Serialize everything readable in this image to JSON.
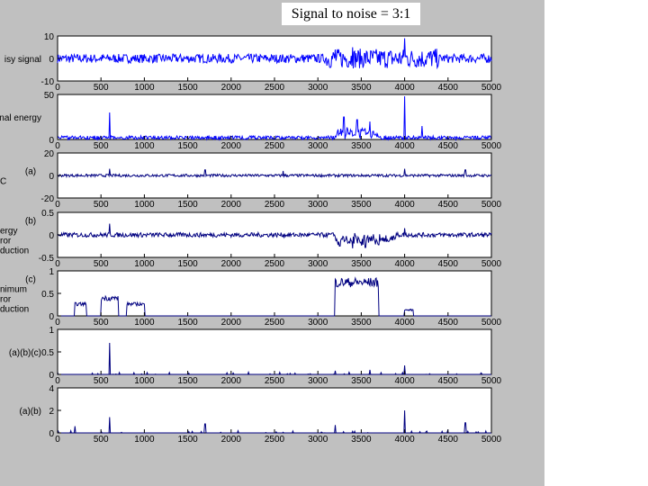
{
  "title": "Signal to noise = 3:1",
  "chart_data": [
    {
      "type": "line",
      "ylabel": "isy signal",
      "ylim": [
        -10,
        10
      ],
      "yticks": [
        "10",
        "0",
        "-10"
      ],
      "noise": 2,
      "spikes": [
        [
          3200,
          4
        ],
        [
          3400,
          5
        ],
        [
          4000,
          9
        ],
        [
          4300,
          3
        ]
      ],
      "color": "#0000ff"
    },
    {
      "type": "line",
      "ylabel": "nal energy",
      "ylim": [
        0,
        50
      ],
      "yticks": [
        "50",
        "0"
      ],
      "noise": 4,
      "spikes": [
        [
          600,
          30
        ],
        [
          3300,
          25
        ],
        [
          3450,
          22
        ],
        [
          3600,
          20
        ],
        [
          4000,
          48
        ],
        [
          4200,
          15
        ]
      ],
      "color": "#0000ff"
    },
    {
      "type": "line",
      "ylabel": "(a)\nC",
      "ylim": [
        -20,
        20
      ],
      "yticks": [
        "20",
        "0",
        "-20"
      ],
      "noise": 1.2,
      "spikes": [
        [
          600,
          6
        ],
        [
          1700,
          5
        ],
        [
          2600,
          4
        ],
        [
          4000,
          6
        ],
        [
          4700,
          5
        ]
      ],
      "color": "#000080"
    },
    {
      "type": "line",
      "ylabel": "(b)\nergy\nror\nduction",
      "ylim": [
        -0.5,
        0.5
      ],
      "yticks": [
        "0.5",
        "0",
        "-0.5"
      ],
      "noise": 0.05,
      "spikes": [
        [
          600,
          0.25
        ],
        [
          3250,
          -0.25
        ],
        [
          3400,
          -0.3
        ],
        [
          3550,
          -0.28
        ],
        [
          3700,
          -0.22
        ],
        [
          4000,
          0.15
        ]
      ],
      "color": "#000080"
    },
    {
      "type": "line",
      "ylabel": "(c)\nnimum\nror\nduction",
      "ylim": [
        0,
        1
      ],
      "yticks": [
        "1",
        "0.5",
        "0"
      ],
      "plateaus": [
        [
          200,
          330,
          0.3
        ],
        [
          500,
          700,
          0.45
        ],
        [
          800,
          1000,
          0.3
        ],
        [
          3200,
          3700,
          0.85
        ],
        [
          4000,
          4100,
          0.15
        ]
      ],
      "color": "#000080"
    },
    {
      "type": "line",
      "ylabel": "(a)(b)(c)",
      "ylim": [
        0,
        1
      ],
      "yticks": [
        "1",
        "0.5",
        "0"
      ],
      "spikes": [
        [
          600,
          0.7
        ],
        [
          4000,
          0.2
        ],
        [
          3200,
          0.08
        ],
        [
          3600,
          0.1
        ],
        [
          2200,
          0.05
        ]
      ],
      "color": "#000080"
    },
    {
      "type": "line",
      "ylabel": "(a)(b)",
      "ylim": [
        0,
        4
      ],
      "yticks": [
        "4",
        "2",
        "0"
      ],
      "spikes": [
        [
          600,
          1.4
        ],
        [
          4000,
          2
        ],
        [
          1700,
          0.8
        ],
        [
          3200,
          0.7
        ],
        [
          4700,
          0.9
        ],
        [
          200,
          0.6
        ]
      ],
      "color": "#000080"
    }
  ],
  "xticks": [
    "0",
    "500",
    "1000",
    "1500",
    "2000",
    "2500",
    "3000",
    "3500",
    "4000",
    "4500",
    "5000"
  ],
  "xlim": [
    0,
    5000
  ]
}
